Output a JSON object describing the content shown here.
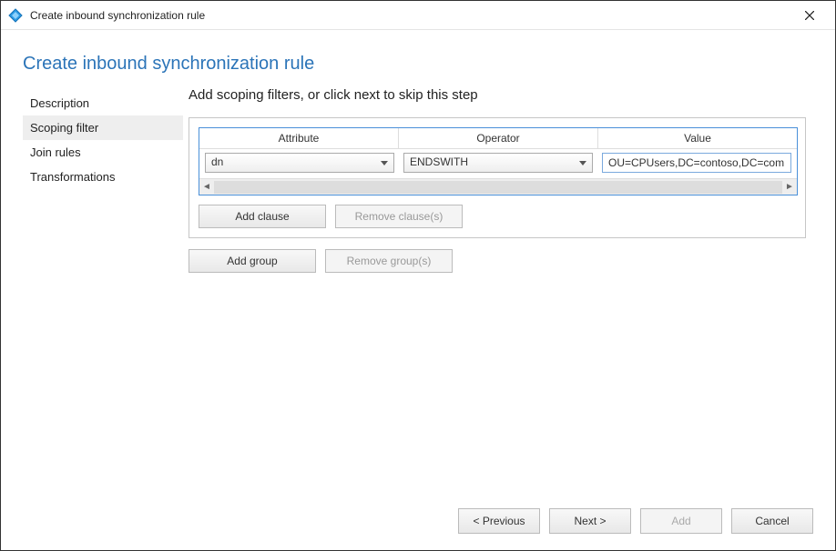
{
  "window": {
    "title": "Create inbound synchronization rule"
  },
  "page": {
    "title": "Create inbound synchronization rule",
    "instruction": "Add scoping filters, or click next to skip this step"
  },
  "sidebar": {
    "items": [
      {
        "label": "Description",
        "selected": false
      },
      {
        "label": "Scoping filter",
        "selected": true
      },
      {
        "label": "Join rules",
        "selected": false
      },
      {
        "label": "Transformations",
        "selected": false
      }
    ]
  },
  "grid": {
    "headers": {
      "attribute": "Attribute",
      "operator": "Operator",
      "value": "Value"
    },
    "row": {
      "attribute": "dn",
      "operator": "ENDSWITH",
      "value": "OU=CPUsers,DC=contoso,DC=com"
    }
  },
  "buttons": {
    "add_clause": "Add clause",
    "remove_clause": "Remove clause(s)",
    "add_group": "Add group",
    "remove_group": "Remove group(s)"
  },
  "footer": {
    "previous": "< Previous",
    "next": "Next >",
    "add": "Add",
    "cancel": "Cancel"
  }
}
